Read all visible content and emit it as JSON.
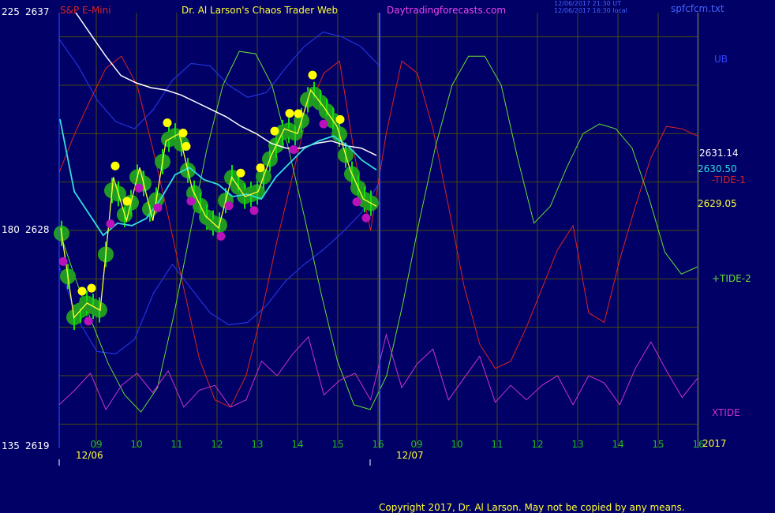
{
  "header": {
    "top_left_1": "225",
    "top_left_2": "2637",
    "instrument": "S&P E-Mini",
    "site_title": "Dr. Al Larson's Chaos Trader Web",
    "site_url": "Daytradingforecasts.com",
    "time_line_1": "12/06/2017 21:30 UT",
    "time_line_2": "12/06/2017 16:30 local",
    "file_name": "spfcfcm.txt"
  },
  "left_axis": {
    "mid_1": "180",
    "mid_2": "2628",
    "bottom_1": "135",
    "bottom_2": "2619"
  },
  "right_labels": {
    "ub": "UB",
    "price_white": "2631.14",
    "price_cyan": "2630.50",
    "tide1": "-TIDE-1",
    "price_yellow": "2629.05",
    "tide2": "+TIDE-2",
    "xtide": "XTIDE",
    "year": "2017"
  },
  "footer": {
    "copyright": "Copyright 2017, Dr. Al Larson. May not be copied by any means."
  },
  "colors": {
    "background": "#000066",
    "grid": "#4a4a10",
    "divider": "#3355ff",
    "envelope": "#2233dd",
    "tide1": "#dd2222",
    "tide2": "#66dd33",
    "xtide": "#cc33cc",
    "price_white": "#ffffff",
    "price_cyan": "#33dddd",
    "price_yellow": "#ffff33",
    "candle_body": "#11dd11",
    "bubble": "#229922",
    "pivot_high": "#ffff00",
    "pivot_low": "#bb11bb"
  },
  "chart_data": {
    "type": "line",
    "title": "S&P E-Mini",
    "y_range_price": [
      2619,
      2637
    ],
    "y_range_scale": [
      135,
      225
    ],
    "x_ticks": [
      {
        "label": "09",
        "day": "12/06"
      },
      {
        "label": "10",
        "day": "12/06"
      },
      {
        "label": "11",
        "day": "12/06"
      },
      {
        "label": "12",
        "day": "12/06"
      },
      {
        "label": "13",
        "day": "12/06"
      },
      {
        "label": "14",
        "day": "12/06"
      },
      {
        "label": "15",
        "day": "12/06"
      },
      {
        "label": "16",
        "day": "12/06"
      },
      {
        "label": "09",
        "day": "12/07"
      },
      {
        "label": "10",
        "day": "12/07"
      },
      {
        "label": "11",
        "day": "12/07"
      },
      {
        "label": "12",
        "day": "12/07"
      },
      {
        "label": "13",
        "day": "12/07"
      },
      {
        "label": "14",
        "day": "12/07"
      },
      {
        "label": "15",
        "day": "12/07"
      },
      {
        "label": "16",
        "day": "12/07"
      }
    ],
    "date_labels": [
      "12/06",
      "12/07"
    ],
    "last_values": {
      "white_average": 2631.14,
      "cyan_average": 2630.5,
      "yellow_average": 2629.05
    },
    "series": [
      {
        "name": "-TIDE-1",
        "values": [
          2630.4,
          2632.0,
          2633.4,
          2634.7,
          2635.2,
          2634.0,
          2631.4,
          2628.6,
          2625.6,
          2622.7,
          2621.0,
          2620.7,
          2622.0,
          2624.6,
          2627.6,
          2630.3,
          2633.0,
          2634.5,
          2635.0,
          2631.0,
          2628.0,
          2632.0,
          2635.0,
          2634.5,
          2632.2,
          2629.0,
          2625.7,
          2623.3,
          2622.3,
          2622.6,
          2624.0,
          2625.6,
          2627.2,
          2628.2,
          2624.6,
          2624.2,
          2626.8,
          2629.0,
          2631.0,
          2632.3,
          2632.2,
          2631.9
        ]
      },
      {
        "name": "+TIDE-2",
        "values": [
          2628.0,
          2626.0,
          2624.2,
          2622.5,
          2621.2,
          2620.5,
          2621.5,
          2624.5,
          2627.9,
          2631.3,
          2634.0,
          2635.4,
          2635.3,
          2634.0,
          2631.4,
          2628.5,
          2625.4,
          2622.6,
          2620.8,
          2620.6,
          2622.0,
          2625.0,
          2628.4,
          2631.5,
          2634.0,
          2635.2,
          2635.2,
          2634.0,
          2631.0,
          2628.3,
          2629.0,
          2630.6,
          2632.0,
          2632.4,
          2632.2,
          2631.4,
          2629.4,
          2627.1,
          2626.2,
          2626.5
        ]
      },
      {
        "name": "white_average",
        "values": [
          2637.0,
          2636.1,
          2635.2,
          2634.4,
          2634.1,
          2633.9,
          2633.8,
          2633.6,
          2633.3,
          2633.0,
          2632.7,
          2632.3,
          2632.0,
          2631.6,
          2631.4,
          2631.4,
          2631.6,
          2631.7,
          2631.5,
          2631.4,
          2631.1
        ]
      },
      {
        "name": "cyan_average",
        "values": [
          2632.6,
          2629.6,
          2628.7,
          2627.8,
          2628.3,
          2628.2,
          2628.5,
          2629.3,
          2630.3,
          2630.6,
          2630.1,
          2629.9,
          2629.4,
          2629.5,
          2629.3,
          2630.2,
          2630.8,
          2631.4,
          2631.7,
          2631.9,
          2631.5,
          2630.9,
          2630.5
        ]
      },
      {
        "name": "yellow_average",
        "values": [
          2628.1,
          2624.4,
          2625.0,
          2624.7,
          2630.2,
          2628.4,
          2630.6,
          2628.4,
          2631.7,
          2632.0,
          2629.7,
          2628.6,
          2628.1,
          2630.2,
          2629.4,
          2629.6,
          2631.1,
          2632.2,
          2632.0,
          2633.8,
          2633.1,
          2632.3,
          2630.5,
          2629.3,
          2629.0
        ]
      },
      {
        "name": "XTIDE",
        "values": [
          2620.8,
          2621.4,
          2622.1,
          2620.6,
          2621.6,
          2622.1,
          2621.3,
          2622.2,
          2620.7,
          2621.4,
          2621.6,
          2620.7,
          2621.0,
          2622.6,
          2622.0,
          2622.9,
          2623.6,
          2621.2,
          2621.8,
          2622.1,
          2621.0,
          2623.7,
          2621.5,
          2622.5,
          2623.1,
          2621.0,
          2621.9,
          2622.8,
          2620.9,
          2621.6,
          2621.0,
          2621.6,
          2622.0,
          2620.8,
          2622.0,
          2621.7,
          2620.8,
          2622.3,
          2623.4,
          2622.2,
          2621.1,
          2621.9
        ]
      }
    ]
  }
}
